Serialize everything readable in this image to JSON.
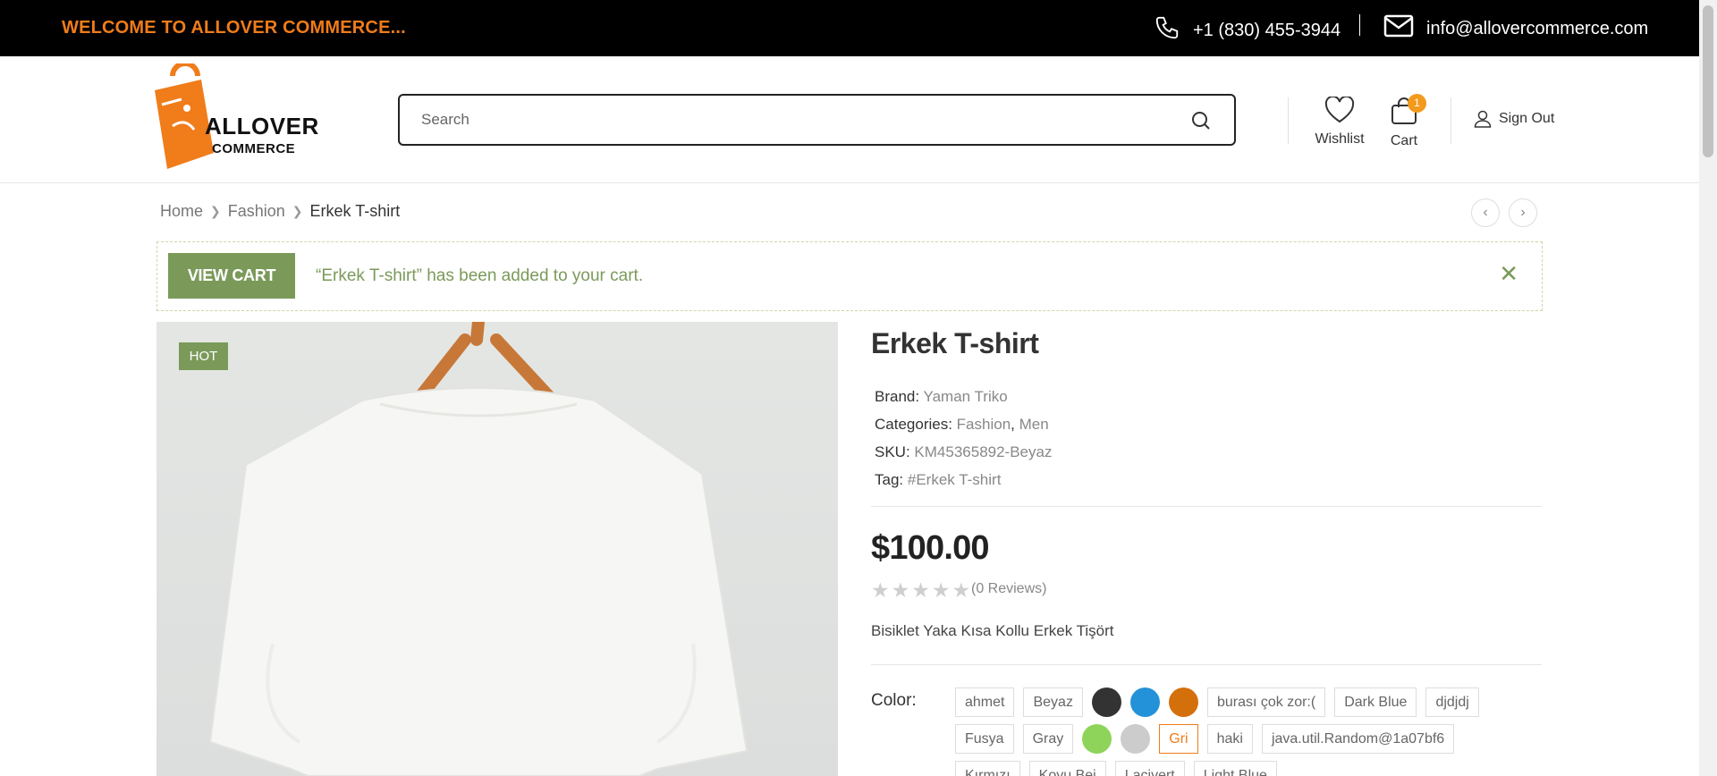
{
  "topbar": {
    "welcome": "WELCOME TO ALLOVER COMMERCE...",
    "phone": "+1 (830) 455-3944",
    "email": "info@allovercommerce.com"
  },
  "header": {
    "logo_line1": "ALLOVER",
    "logo_line2": "COMMERCE",
    "search_placeholder": "Search",
    "wishlist_label": "Wishlist",
    "cart_label": "Cart",
    "cart_count": "1",
    "signout_label": "Sign Out"
  },
  "breadcrumb": {
    "items": [
      "Home",
      "Fashion",
      "Erkek T-shirt"
    ]
  },
  "notice": {
    "button": "VIEW CART",
    "message": "“Erkek T-shirt” has been added to your cart."
  },
  "product": {
    "badge": "HOT",
    "title": "Erkek T-shirt",
    "brand_label": "Brand:",
    "brand": "Yaman Triko",
    "categories_label": "Categories:",
    "category_1": "Fashion",
    "category_sep": ",",
    "category_2": "Men",
    "sku_label": "SKU:",
    "sku": "KM45365892-Beyaz",
    "tag_label": "Tag:",
    "tag": "#Erkek T-shirt",
    "price": "$100.00",
    "rating": 0,
    "reviews": "(0 Reviews)",
    "description": "Bisiklet Yaka Kısa Kollu Erkek Tişört",
    "color_label": "Color:",
    "colors": [
      {
        "type": "text",
        "label": "ahmet"
      },
      {
        "type": "text",
        "label": "Beyaz"
      },
      {
        "type": "swatch",
        "color": "#333333"
      },
      {
        "type": "swatch",
        "color": "#2492d8"
      },
      {
        "type": "swatch",
        "color": "#d4700c"
      },
      {
        "type": "text",
        "label": "burası çok zor:("
      },
      {
        "type": "text",
        "label": "Dark Blue"
      },
      {
        "type": "text",
        "label": "djdjdj"
      },
      {
        "type": "text",
        "label": "Fusya"
      },
      {
        "type": "text",
        "label": "Gray"
      },
      {
        "type": "swatch",
        "color": "#8ed45a"
      },
      {
        "type": "swatch",
        "color": "#cccccc"
      },
      {
        "type": "text",
        "label": "Gri",
        "selected": true
      },
      {
        "type": "text",
        "label": "haki"
      },
      {
        "type": "text",
        "label": "java.util.Random@1a07bf6"
      },
      {
        "type": "text",
        "label": "Kırmızı"
      },
      {
        "type": "text",
        "label": "Koyu Bej"
      },
      {
        "type": "text",
        "label": "Lacivert"
      },
      {
        "type": "text",
        "label": "Light Blue"
      }
    ]
  },
  "theme": {
    "accent": "#f07c1a",
    "green": "#7b9a5a",
    "badge": "#f29a1c"
  }
}
